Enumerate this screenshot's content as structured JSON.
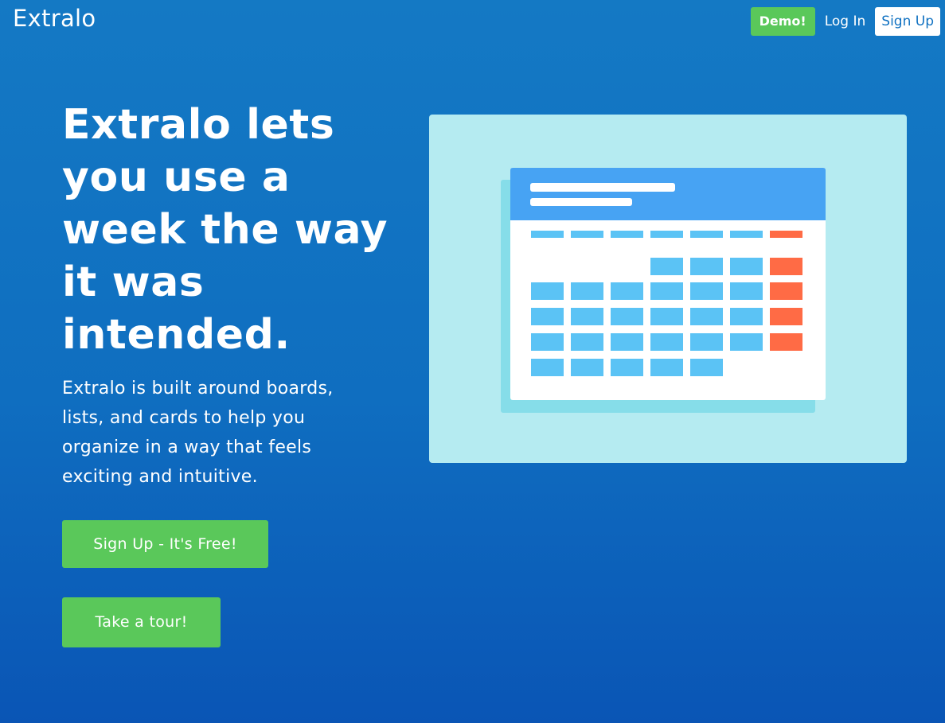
{
  "header": {
    "logo": "Extralo",
    "demo_label": "Demo!",
    "login_label": "Log In",
    "signup_label": "Sign Up"
  },
  "hero": {
    "title": "Extralo lets you use a week the way it was intended.",
    "subtitle": "Extralo is built around boards, lists, and cards to help you organize in a way that feels exciting and intuitive.",
    "cta_signup": "Sign Up - It's Free!",
    "cta_tour": "Take a tour!"
  },
  "colors": {
    "background_top": "#1479c4",
    "background_bottom": "#0a55b5",
    "accent_green": "#5ac85a",
    "illustration_bg": "#b5ebf1",
    "calendar_header": "#47a3f3",
    "calendar_cell": "#5bc3f5",
    "calendar_weekend": "#ff6b45"
  },
  "icons": {
    "illustration": "calendar-icon"
  }
}
